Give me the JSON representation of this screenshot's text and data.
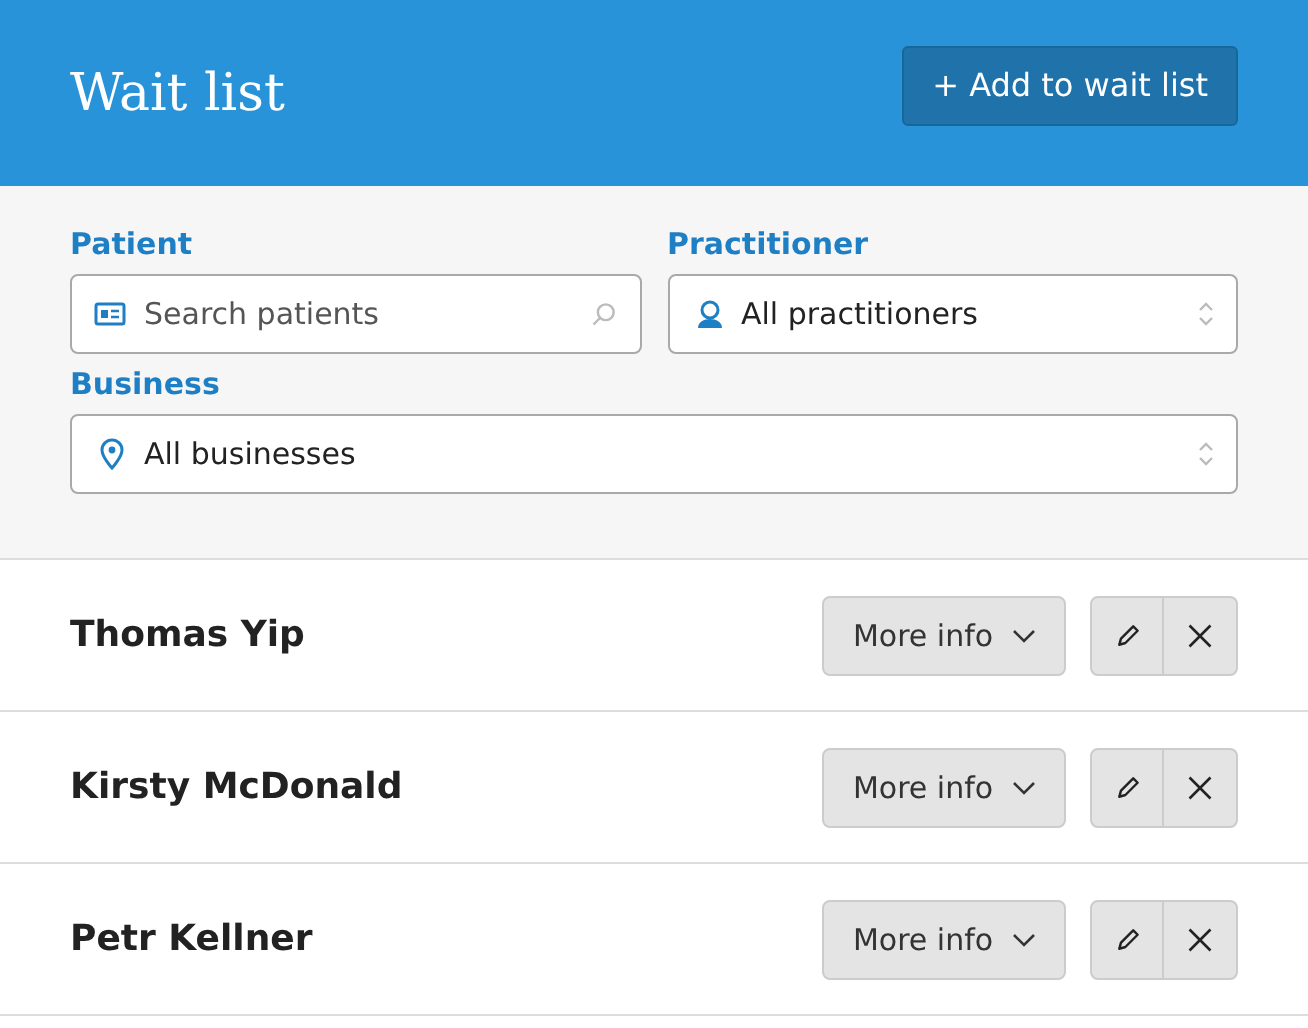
{
  "header": {
    "title": "Wait list",
    "add_button": "+ Add to wait list"
  },
  "filters": {
    "patient": {
      "label": "Patient",
      "placeholder": "Search patients"
    },
    "practitioner": {
      "label": "Practitioner",
      "value": "All practitioners"
    },
    "business": {
      "label": "Business",
      "value": "All businesses"
    }
  },
  "entries": [
    {
      "name": "Thomas Yip",
      "more_button": "More info"
    },
    {
      "name": "Kirsty McDonald",
      "more_button": "More info"
    },
    {
      "name": "Petr Kellner",
      "more_button": "More info"
    }
  ]
}
